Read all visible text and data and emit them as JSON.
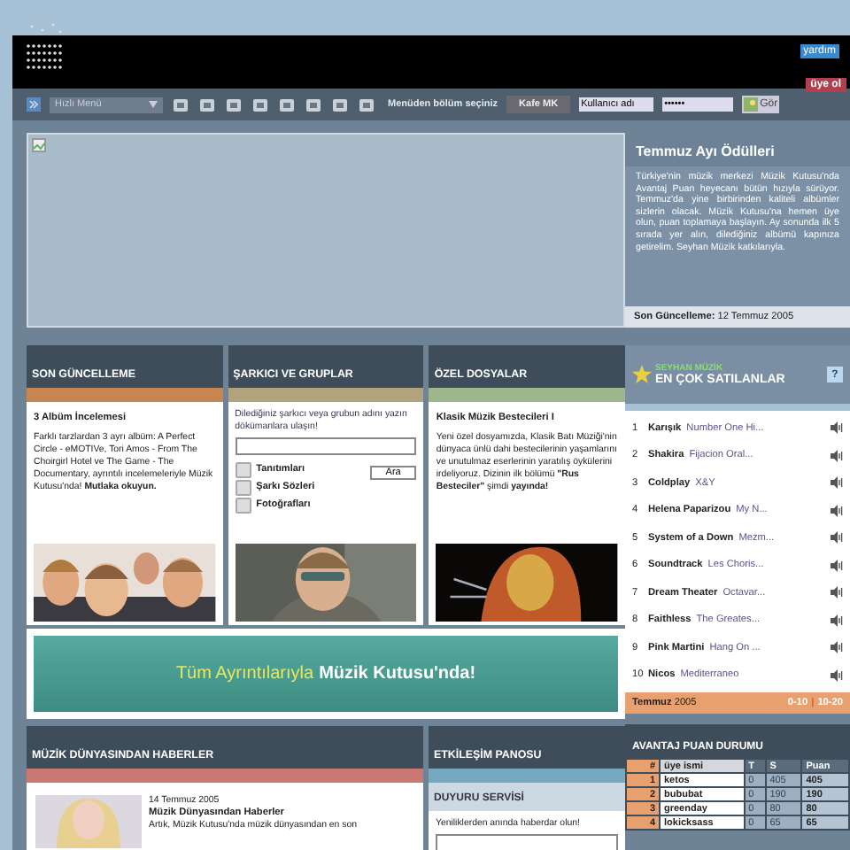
{
  "header": {
    "help_button": "yardım",
    "signup_button": "üye ol"
  },
  "toolbar": {
    "quick_menu": "Hızlı Menü",
    "hint": "Menüden bölüm seçiniz",
    "cafe_button": "Kafe MK",
    "username": "Kullanıcı adı",
    "password": "••••••",
    "go_button": "Gör"
  },
  "award": {
    "title": "Temmuz Ayı Ödülleri",
    "text": "Türkiye'nin müzik merkezi Müzik Kutusu'nda Avantaj Puan heyecanı bütün hızıyla sürüyor. Temmuz'da yine birbirinden kaliteli albümler sizlerin olacak. Müzik Kutusu'na hemen üye olun, puan toplamaya başlayın. Ay sonunda ilk 5 sırada yer alın, dilediğiniz albümü kapınıza getirelim. Seyhan Müzik katkılarıyla.",
    "updated_label": "Son Güncelleme:",
    "updated_date": "12 Temmuz 2005"
  },
  "columns": [
    {
      "kind": "article",
      "title": "SON GÜNCELLEME",
      "color": "#c8854f",
      "heading": "3 Albüm İncelemesi",
      "text": "Farklı tarzlardan 3 ayrı albüm: A Perfect Circle - eMOTIVe, Tori Amos - From The Choirgirl Hotel ve The Game - The Documentary, ayrıntılı incelemeleriyle Müzik Kutusu'nda! **Mutlaka okuyun.**"
    },
    {
      "kind": "search",
      "title": "ŞARKICI VE GRUPLAR",
      "color": "#b2a37c",
      "text": "Dilediğiniz şarkıcı veya grubun adını yazın dökümanlara ulaşın!",
      "button": "Ara",
      "options": [
        {
          "label": "Tanıtımları",
          "checked": false
        },
        {
          "label": "Şarkı Sözleri",
          "checked": false
        },
        {
          "label": "Fotoğrafları",
          "checked": false
        }
      ]
    },
    {
      "kind": "article",
      "title": "ÖZEL DOSYALAR",
      "color": "#9db68d",
      "heading": "Klasik Müzik Bestecileri I",
      "text": "Yeni özel dosyamızda, Klasik Batı Müziği'nin dünyaca ünlü dahi bestecilerinin yaşamlarını ve unutulmaz eserlerinin yaratılış öykülerini irdeliyoruz. Dizinin ilk bölümü **\"Rus Besteciler\"** şimdi **yayında!**"
    }
  ],
  "promo": {
    "lead": "Tüm Ayrıntılarıyla",
    "highlight": "Müzik Kutusu'nda!"
  },
  "news": {
    "title": "MÜZİK DÜNYASINDAN HABERLER",
    "date": "14 Temmuz 2005",
    "heading": "Müzik Dünyasından Haberler",
    "text": "Artık, Müzik Kutusu'nda müzik dünyasından en son"
  },
  "board": {
    "title": "ETKİLEŞİM PANOSU",
    "subtitle": "DUYURU SERVİSİ",
    "text": "Yeniliklerden anında haberdar olun!"
  },
  "bestsellers": {
    "brand": "SEYHAN MÜZİK",
    "title": "EN ÇOK SATILANLAR",
    "help": "?",
    "items": [
      {
        "rank": "1",
        "artist": "Karışık",
        "album": "Number One Hi..."
      },
      {
        "rank": "2",
        "artist": "Shakira",
        "album": "Fijacion Oral..."
      },
      {
        "rank": "3",
        "artist": "Coldplay",
        "album": "X&Y"
      },
      {
        "rank": "4",
        "artist": "Helena Paparizou",
        "album": "My N..."
      },
      {
        "rank": "5",
        "artist": "System of a Down",
        "album": "Mezm..."
      },
      {
        "rank": "6",
        "artist": "Soundtrack",
        "album": "Les Choris..."
      },
      {
        "rank": "7",
        "artist": "Dream Theater",
        "album": "Octavar..."
      },
      {
        "rank": "8",
        "artist": "Faithless",
        "album": "The Greates..."
      },
      {
        "rank": "9",
        "artist": "Pink Martini",
        "album": "Hang On ..."
      },
      {
        "rank": "10",
        "artist": "Nicos",
        "album": "Mediterraneo"
      }
    ],
    "month": "Temmuz",
    "year": "2005",
    "pages": [
      "0-10",
      "10-20"
    ],
    "separator": "|"
  },
  "points": {
    "title": "AVANTAJ PUAN DURUMU",
    "columns": [
      "#",
      "üye ismi",
      "T",
      "S",
      "Puan"
    ],
    "rows": [
      [
        "1",
        "ketos",
        "0",
        "405",
        "405"
      ],
      [
        "2",
        "bububat",
        "0",
        "190",
        "190"
      ],
      [
        "3",
        "greenday",
        "0",
        "80",
        "80"
      ],
      [
        "4",
        "lokicksass",
        "0",
        "65",
        "65"
      ]
    ]
  }
}
